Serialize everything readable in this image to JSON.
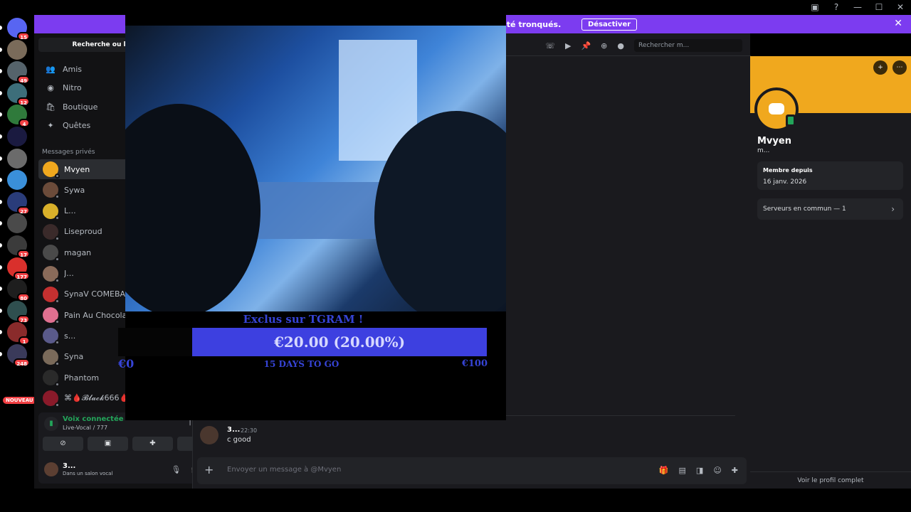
{
  "banner": {
    "text": "ité tronqués.",
    "button": "Désactiver"
  },
  "servers": [
    {
      "badge": "15",
      "color": "#5865f2"
    },
    {
      "badge": "",
      "color": "#7a6b5a"
    },
    {
      "badge": "49",
      "color": "#55636b"
    },
    {
      "badge": "12",
      "color": "#3d6e7a"
    },
    {
      "badge": "4",
      "color": "#2f7a3b"
    },
    {
      "badge": "",
      "color": "#1a1a40"
    },
    {
      "badge": "",
      "color": "#6b6b6b"
    },
    {
      "badge": "",
      "color": "#3a8fd9"
    },
    {
      "badge": "27",
      "color": "#2a3c7a"
    },
    {
      "badge": "",
      "color": "#4a4a4a"
    },
    {
      "badge": "17",
      "color": "#3b3b3b"
    },
    {
      "badge": "177",
      "color": "#d9302c"
    },
    {
      "badge": "80",
      "color": "#1e1e1e"
    },
    {
      "badge": "73",
      "color": "#2f4f4f"
    },
    {
      "badge": "1",
      "color": "#8a2b2b"
    },
    {
      "badge": "248",
      "color": "#3a3a5a"
    }
  ],
  "nouveau": "NOUVEAU",
  "dm_panel": {
    "search": "Recherche ou lance un",
    "nav": [
      {
        "label": "Amis",
        "icon": "👥"
      },
      {
        "label": "Nitro",
        "icon": "◉"
      },
      {
        "label": "Boutique",
        "icon": "🛍"
      },
      {
        "label": "Quêtes",
        "icon": "✦"
      }
    ],
    "header": "Messages privés",
    "dms": [
      {
        "name": "Mvyen",
        "color": "#f0a81e"
      },
      {
        "name": "Sywa",
        "color": "#6b4b3a"
      },
      {
        "name": "L...",
        "color": "#d9b02a"
      },
      {
        "name": "Liseproud",
        "color": "#3a2a2a"
      },
      {
        "name": "magan",
        "color": "#4a4a4a"
      },
      {
        "name": "J...",
        "color": "#8a6b5a"
      },
      {
        "name": "SynaV COMEBACK",
        "color": "#c43030"
      },
      {
        "name": "Pain Au Chocolat",
        "color": "#e07090"
      },
      {
        "name": "s...",
        "color": "#5a5a8a"
      },
      {
        "name": "Syna",
        "color": "#7a6a5a"
      },
      {
        "name": "Phantom",
        "color": "#2a2a2a"
      },
      {
        "name": "⌘🩸𝓑𝓵𝓪𝓬𝓴666🩸",
        "color": "#8a1a2a"
      }
    ]
  },
  "voice": {
    "title": "Voix connectée",
    "subtitle": "Live-Vocal / 777",
    "user_name": "3...",
    "user_status": "Dans un salon vocal"
  },
  "chat": {
    "search_placeholder": "Rechercher m...",
    "message": {
      "author": "3...",
      "time": "22:30",
      "text": "c good"
    },
    "composer_placeholder": "Envoyer un message à @Mvyen"
  },
  "profile": {
    "name": "Mvyen",
    "username": "m...",
    "member_since_label": "Membre depuis",
    "member_since": "16 janv. 2026",
    "servers_common": "Serveurs en commun — 1",
    "full_profile": "Voir le profil complet",
    "banner_color": "#f0a81e"
  },
  "stream": {
    "title": "Exclus sur TGRAM !",
    "amount": "€20.00 (20.00%)",
    "progress": 0.2,
    "min": "€0",
    "days": "15 DAYS TO GO",
    "max": "€100"
  }
}
